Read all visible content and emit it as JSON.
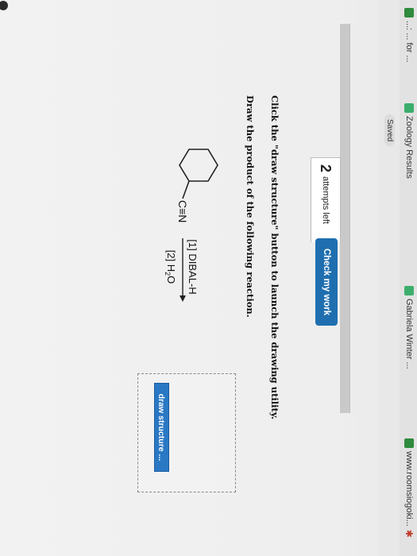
{
  "bookmarks": [
    {
      "label": "...: ... for ...",
      "icon": "bookmark-icon"
    },
    {
      "label": "Zoology Results",
      "icon": "leaf-icon"
    },
    {
      "label": "Gabriela Winter ...",
      "icon": "leaf-icon"
    },
    {
      "label": "www.roomsiogoki...",
      "icon": "globe-icon"
    }
  ],
  "status": {
    "saved": "Saved"
  },
  "attempts": {
    "count": "2",
    "label": "attempts left"
  },
  "check_button": "Check my work",
  "instructions": {
    "line1": "Click the \"draw structure\" button to launch the drawing utility.",
    "line2": "Draw the product of the following reaction."
  },
  "reaction": {
    "nitrile": "C≡N",
    "reagent1": "[1] DIBAL-H",
    "reagent2": "[2] H",
    "reagent2_sub": "2",
    "reagent2_tail": "O"
  },
  "draw_button": "draw structure ...",
  "colors": {
    "accent": "#1f6fb0",
    "draw_button": "#2a78c4"
  }
}
